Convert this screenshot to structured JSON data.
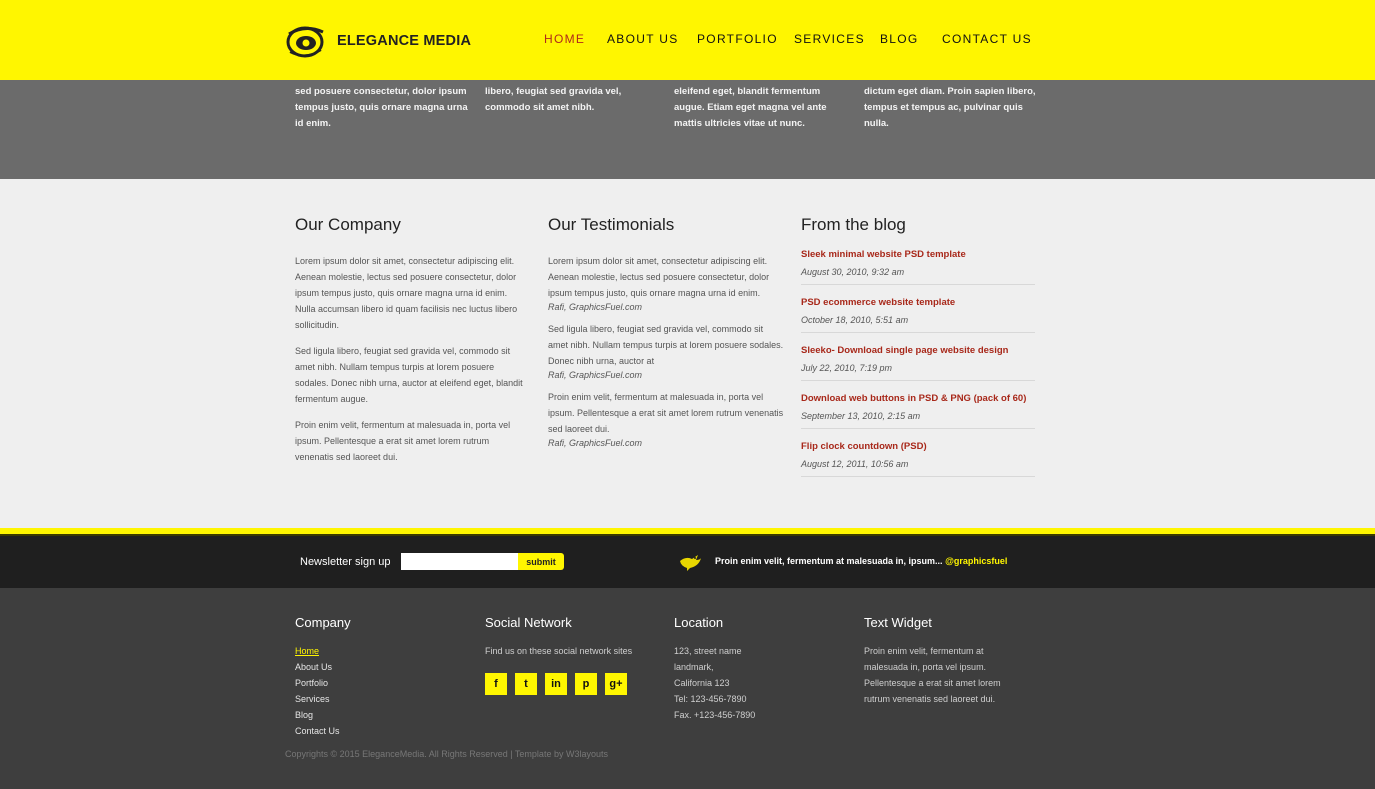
{
  "header": {
    "logo_text": "ELEGANCE MEDIA",
    "nav": [
      "HOME",
      "ABOUT US",
      "PORTFOLIO",
      "SERVICES",
      "BLOG",
      "CONTACT US"
    ]
  },
  "strip": {
    "cols": [
      "sed posuere consectetur, dolor ipsum tempus justo, quis ornare magna urna id enim.",
      "libero, feugiat sed gravida vel, commodo sit amet nibh.",
      "eleifend eget, blandit fermentum augue. Etiam eget magna vel ante mattis ultricies vitae ut nunc.",
      "dictum eget diam. Proin sapien libero, tempus et tempus ac, pulvinar quis nulla."
    ]
  },
  "company": {
    "title": "Our Company",
    "paras": [
      "Lorem ipsum dolor sit amet, consectetur adipiscing elit. Aenean molestie, lectus sed posuere consectetur, dolor ipsum tempus justo, quis ornare magna urna id enim. Nulla accumsan libero id quam facilisis nec luctus libero sollicitudin.",
      "Sed ligula libero, feugiat sed gravida vel, commodo sit amet nibh. Nullam tempus turpis at lorem posuere sodales. Donec nibh urna, auctor at eleifend eget, blandit fermentum augue.",
      "Proin enim velit, fermentum at malesuada in, porta vel ipsum. Pellentesque a erat sit amet lorem rutrum venenatis sed laoreet dui."
    ]
  },
  "testimonials": {
    "title": "Our Testimonials",
    "items": [
      {
        "text": "Lorem ipsum dolor sit amet, consectetur adipiscing elit. Aenean molestie, lectus sed posuere consectetur, dolor ipsum tempus justo, quis ornare magna urna id enim.",
        "cite": "Rafi, GraphicsFuel.com"
      },
      {
        "text": "Sed ligula libero, feugiat sed gravida vel, commodo sit amet nibh. Nullam tempus turpis at lorem posuere sodales. Donec nibh urna, auctor at",
        "cite": "Rafi, GraphicsFuel.com"
      },
      {
        "text": "Proin enim velit, fermentum at malesuada in, porta vel ipsum. Pellentesque a erat sit amet lorem rutrum venenatis sed laoreet dui.",
        "cite": "Rafi, GraphicsFuel.com"
      }
    ]
  },
  "blog": {
    "title": "From the blog",
    "items": [
      {
        "title": "Sleek minimal website PSD template",
        "date": "August 30, 2010, 9:32 am"
      },
      {
        "title": "PSD ecommerce website template",
        "date": "October 18, 2010, 5:51 am"
      },
      {
        "title": "Sleeko- Download single page website design",
        "date": "July 22, 2010, 7:19 pm"
      },
      {
        "title": "Download web buttons in PSD & PNG (pack of 60)",
        "date": "September 13, 2010, 2:15 am"
      },
      {
        "title": "Flip clock countdown (PSD)",
        "date": "August 12, 2011, 10:56 am"
      }
    ]
  },
  "newsletter": {
    "label": "Newsletter sign up",
    "input_value": "",
    "button": "submit",
    "tweet_text": "Proin enim velit, fermentum at malesuada in, ipsum... ",
    "tweet_handle": "@graphicsfuel"
  },
  "footer": {
    "company": {
      "title": "Company",
      "links": [
        "Home",
        "About Us",
        "Portfolio",
        "Services",
        "Blog",
        "Contact Us"
      ]
    },
    "social": {
      "title": "Social Network",
      "text": "Find us on these social network sites",
      "icons": [
        "facebook-icon",
        "twitter-icon",
        "linkedin-icon",
        "pinterest-icon",
        "googleplus-icon"
      ],
      "glyphs": [
        "f",
        "t",
        "in",
        "p",
        "g+"
      ]
    },
    "location": {
      "title": "Location",
      "lines": [
        "123, street name",
        "landmark,",
        "California 123",
        "Tel: 123-456-7890",
        "Fax. +123-456-7890"
      ]
    },
    "widget": {
      "title": "Text Widget",
      "text": "Proin enim velit, fermentum at malesuada in, porta vel ipsum. Pellentesque a erat sit amet lorem rutrum venenatis sed laoreet dui."
    },
    "copyright": "Copyrights © 2015 EleganceMedia. All Rights Reserved | Template by W3layouts"
  },
  "colors": {
    "accent": "#fff600",
    "link_red": "#a8281a",
    "dark": "#1f1f1f",
    "footer_bg": "#3e3e3e"
  }
}
